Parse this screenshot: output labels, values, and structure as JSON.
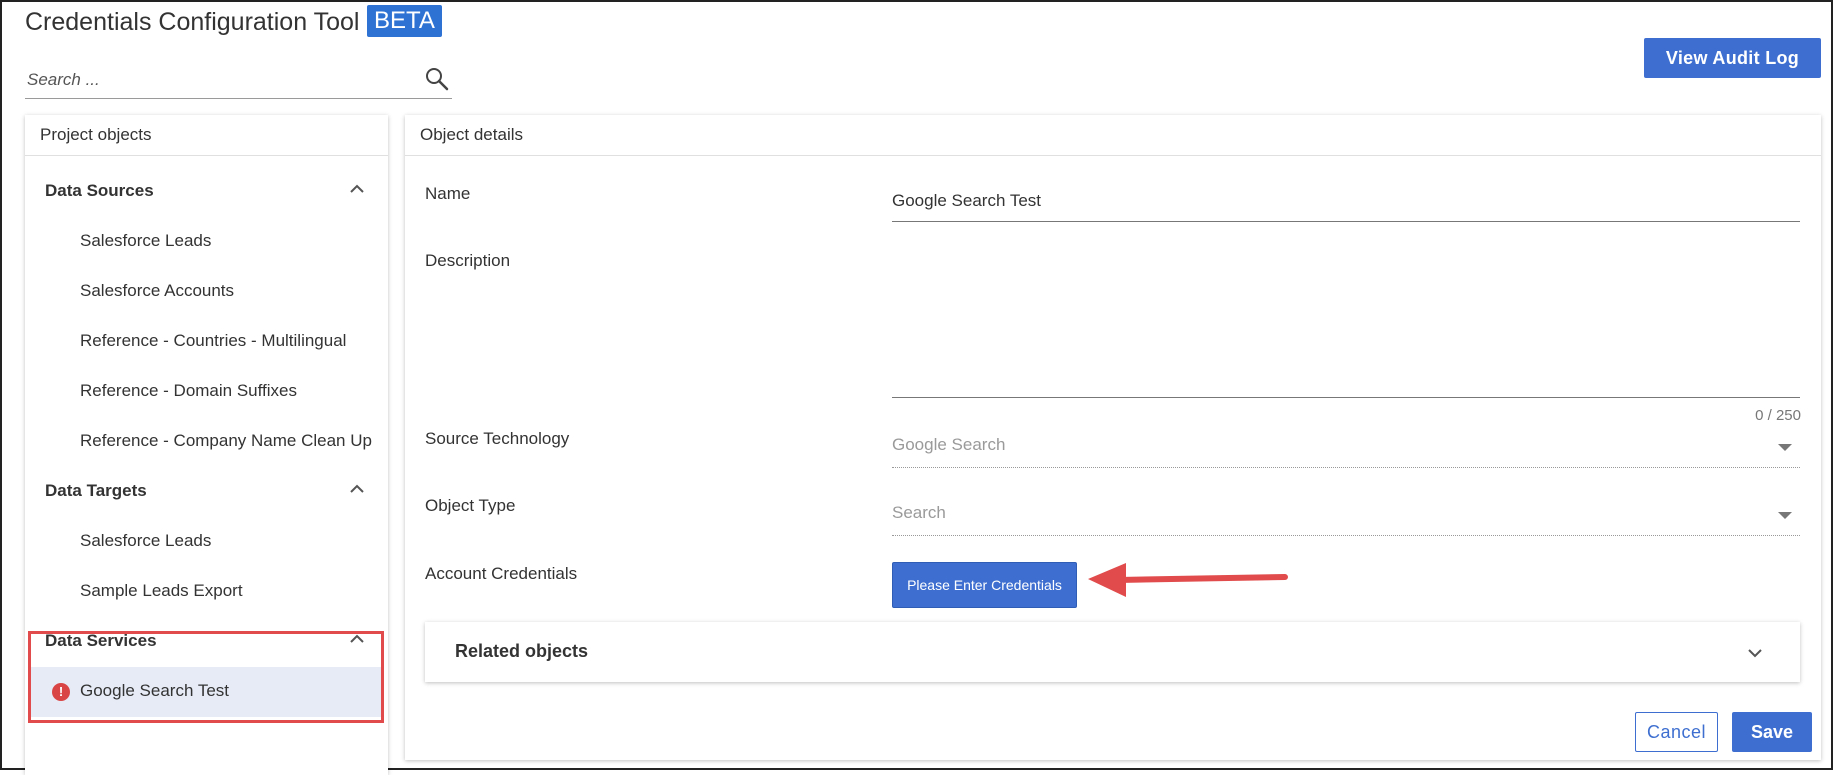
{
  "app": {
    "title": "Credentials Configuration Tool",
    "badge": "BETA"
  },
  "search": {
    "placeholder": "Search ..."
  },
  "toolbar": {
    "audit_label": "View Audit Log"
  },
  "left_panel": {
    "header": "Project objects",
    "groups": [
      {
        "title": "Data Sources",
        "items": [
          "Salesforce Leads",
          "Salesforce Accounts",
          "Reference - Countries - Multilingual",
          "Reference - Domain Suffixes",
          "Reference - Company Name Clean Up"
        ]
      },
      {
        "title": "Data Targets",
        "items": [
          "Salesforce Leads",
          "Sample Leads Export"
        ]
      },
      {
        "title": "Data Services",
        "items": [
          "Google Search Test"
        ]
      }
    ],
    "selected_item": "Google Search Test",
    "selected_status_icon": "error-icon"
  },
  "details": {
    "header": "Object details",
    "fields": {
      "name_label": "Name",
      "name_value": "Google Search Test",
      "description_label": "Description",
      "description_value": "",
      "description_counter": "0 / 250",
      "source_label": "Source Technology",
      "source_value": "Google Search",
      "object_type_label": "Object Type",
      "object_type_placeholder": "Search",
      "credentials_label": "Account Credentials",
      "credentials_button": "Please Enter Credentials"
    },
    "related": {
      "title": "Related objects"
    },
    "actions": {
      "cancel": "Cancel",
      "save": "Save"
    }
  },
  "colors": {
    "accent": "#3e6fd0",
    "beta": "#2e73d4",
    "error": "#d94545",
    "highlight": "#e14b4b",
    "selected_bg": "#e6ebf6"
  }
}
